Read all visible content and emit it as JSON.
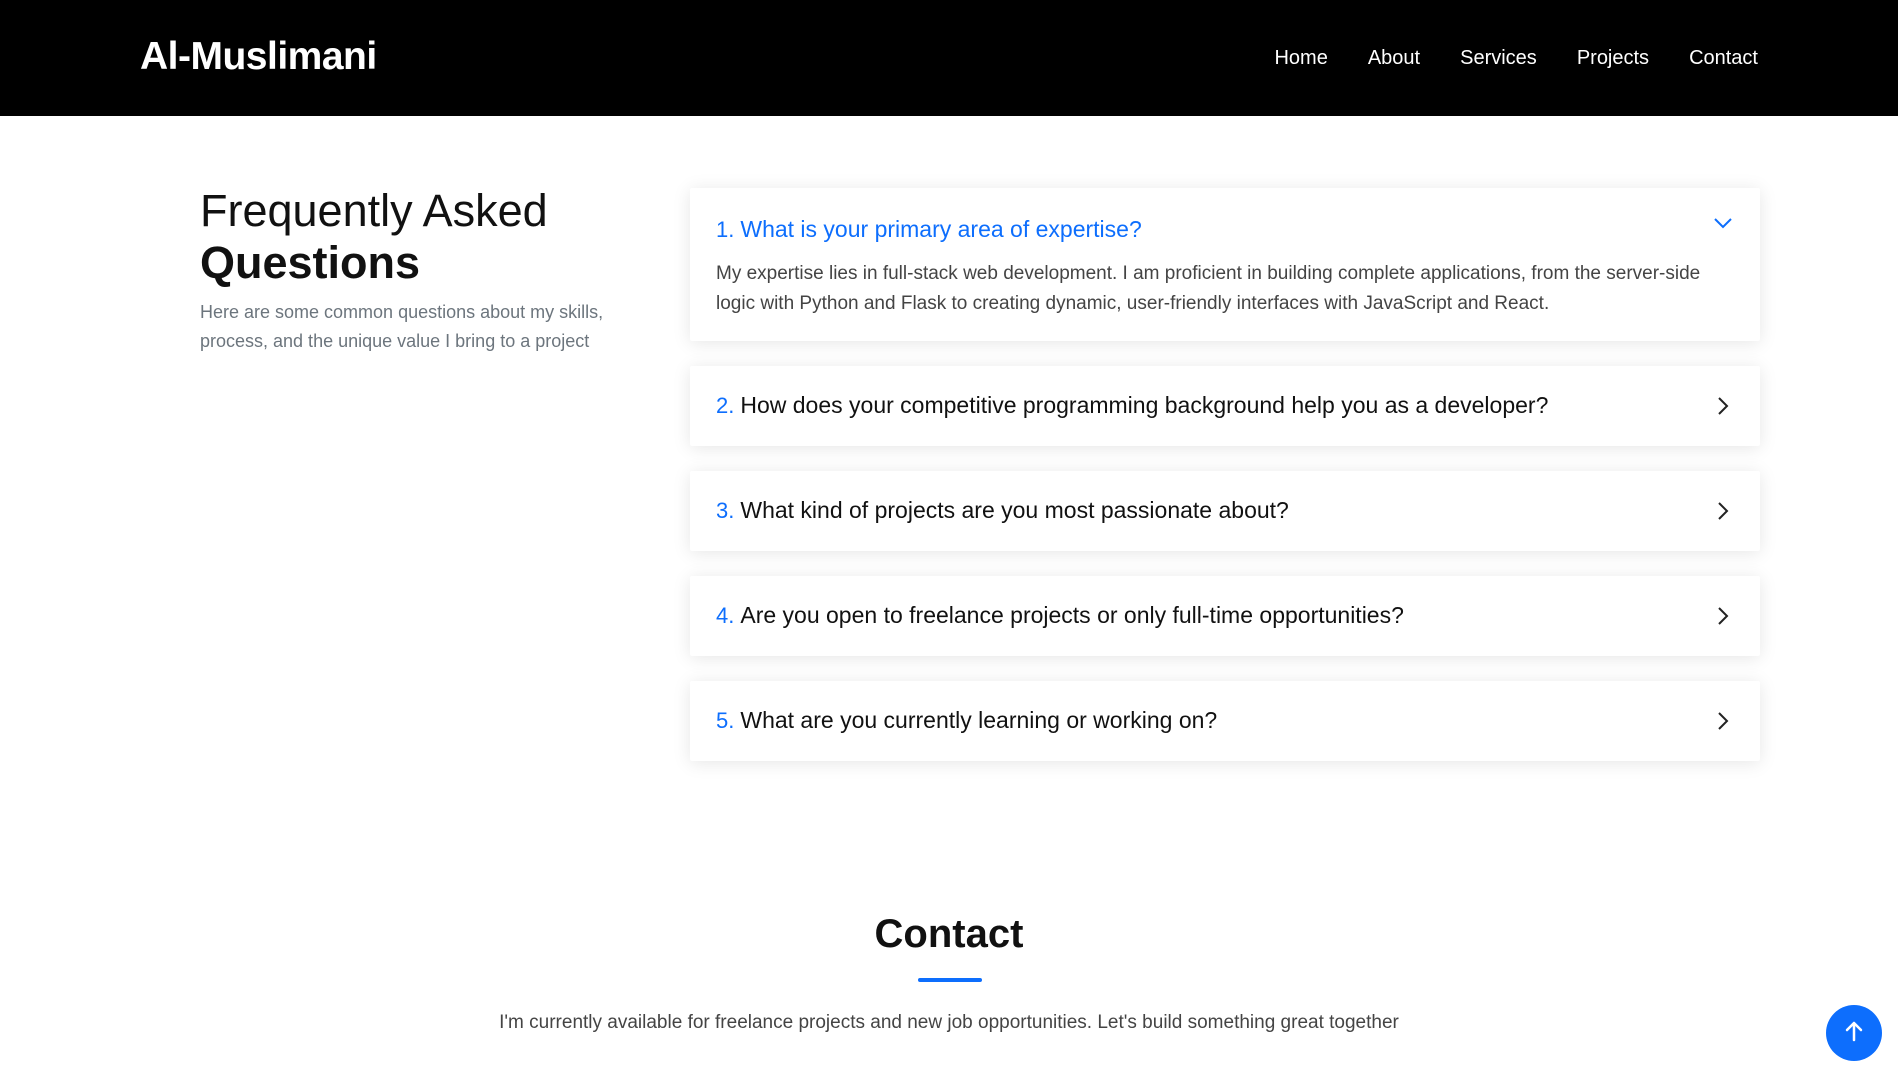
{
  "header": {
    "logo": "Al-Muslimani",
    "nav": [
      "Home",
      "About",
      "Services",
      "Projects",
      "Contact"
    ]
  },
  "faq": {
    "title_light": "Frequently Asked",
    "title_bold": "Questions",
    "description": "Here are some common questions about my skills, process, and the unique value I bring to a project",
    "items": [
      {
        "number": "1.",
        "question": "What is your primary area of expertise?",
        "answer": "My expertise lies in full-stack web development. I am proficient in building complete applications, from the server-side logic with Python and Flask to creating dynamic, user-friendly interfaces with JavaScript and React.",
        "expanded": true
      },
      {
        "number": "2.",
        "question": "How does your competitive programming background help you as a developer?",
        "expanded": false
      },
      {
        "number": "3.",
        "question": "What kind of projects are you most passionate about?",
        "expanded": false
      },
      {
        "number": "4.",
        "question": "Are you open to freelance projects or only full-time opportunities?",
        "expanded": false
      },
      {
        "number": "5.",
        "question": "What are you currently learning or working on?",
        "expanded": false
      }
    ]
  },
  "contact": {
    "title": "Contact",
    "description": "I'm currently available for freelance projects and new job opportunities. Let's build something great together"
  },
  "icons": {
    "expanded": "chevron-down-icon",
    "collapsed": "chevron-right-icon",
    "back_to_top": "arrow-up-icon"
  },
  "colors": {
    "accent": "#0d6efd",
    "header_bg": "#000000"
  }
}
